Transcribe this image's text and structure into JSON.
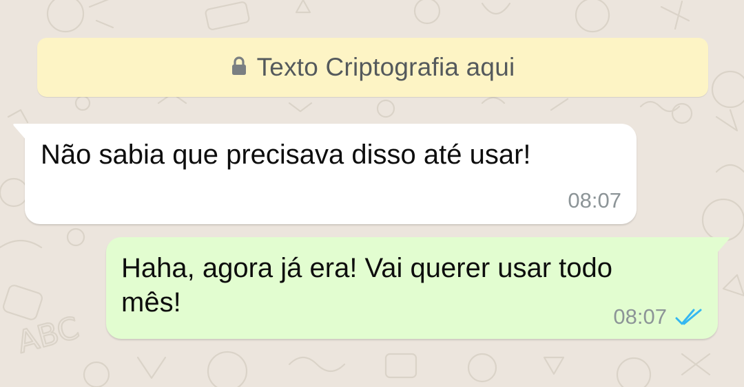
{
  "theme": {
    "wallpaper": "#ece5dd",
    "banner_bg": "#fdf4c5",
    "incoming_bg": "#ffffff",
    "outgoing_bg": "#e2fdd0",
    "read_ticks": "#34b7f1"
  },
  "banner": {
    "icon": "lock-icon",
    "text": "Texto Criptografia aqui"
  },
  "messages": [
    {
      "direction": "incoming",
      "text": "Não sabia que precisava disso até usar!",
      "time": "08:07"
    },
    {
      "direction": "outgoing",
      "text": "Haha, agora já era! Vai querer usar todo mês!",
      "time": "08:07",
      "status_icon": "double-check-read-icon"
    }
  ]
}
